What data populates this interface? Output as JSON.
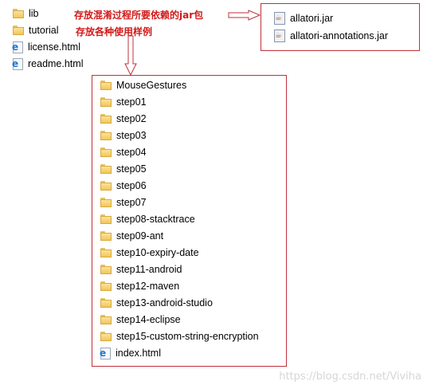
{
  "root_items": [
    {
      "label": "lib",
      "icon": "folder-icon"
    },
    {
      "label": "tutorial",
      "icon": "folder-icon"
    },
    {
      "label": "license.html",
      "icon": "html-file-icon"
    },
    {
      "label": "readme.html",
      "icon": "html-file-icon"
    }
  ],
  "lib_contents": [
    {
      "label": "allatori.jar",
      "icon": "jar-file-icon"
    },
    {
      "label": "allatori-annotations.jar",
      "icon": "jar-file-icon"
    }
  ],
  "tutorial_contents": [
    {
      "label": "MouseGestures",
      "icon": "folder-icon"
    },
    {
      "label": "step01",
      "icon": "folder-icon"
    },
    {
      "label": "step02",
      "icon": "folder-icon"
    },
    {
      "label": "step03",
      "icon": "folder-icon"
    },
    {
      "label": "step04",
      "icon": "folder-icon"
    },
    {
      "label": "step05",
      "icon": "folder-icon"
    },
    {
      "label": "step06",
      "icon": "folder-icon"
    },
    {
      "label": "step07",
      "icon": "folder-icon"
    },
    {
      "label": "step08-stacktrace",
      "icon": "folder-icon"
    },
    {
      "label": "step09-ant",
      "icon": "folder-icon"
    },
    {
      "label": "step10-expiry-date",
      "icon": "folder-icon"
    },
    {
      "label": "step11-android",
      "icon": "folder-icon"
    },
    {
      "label": "step12-maven",
      "icon": "folder-icon"
    },
    {
      "label": "step13-android-studio",
      "icon": "folder-icon"
    },
    {
      "label": "step14-eclipse",
      "icon": "folder-icon"
    },
    {
      "label": "step15-custom-string-encryption",
      "icon": "folder-icon"
    },
    {
      "label": "index.html",
      "icon": "html-file-icon"
    }
  ],
  "annotations": {
    "lib_note": "存放混淆过程所要依赖的jar包",
    "tutorial_note": "存放各种使用样例"
  },
  "watermark": "https://blog.csdn.net/Viviha",
  "colors": {
    "annotation_red": "#d11a1a",
    "box_border": "#c0313a",
    "folder_yellow": "#f2c65b"
  }
}
